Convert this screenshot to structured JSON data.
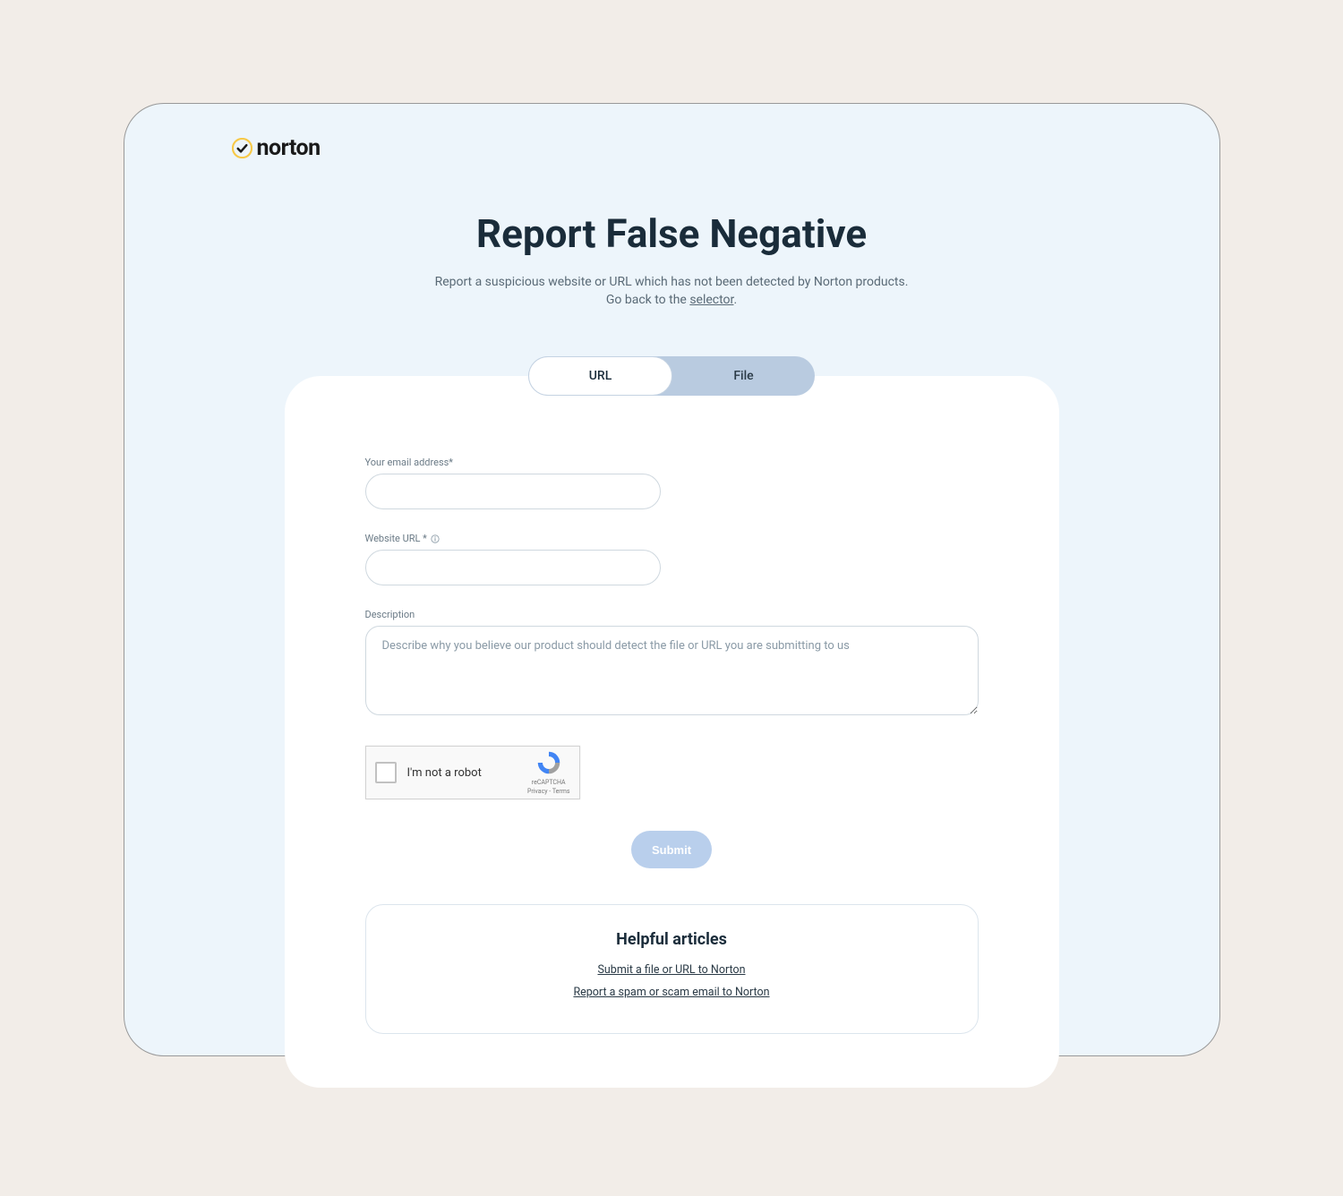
{
  "logo": {
    "text": "norton"
  },
  "header": {
    "title": "Report False Negative",
    "subtitle_line1": "Report a suspicious website or URL which has not been detected by Norton products.",
    "subtitle_line2_prefix": "Go back to the ",
    "subtitle_line2_link": "selector",
    "subtitle_line2_suffix": "."
  },
  "tabs": {
    "url": "URL",
    "file": "File"
  },
  "form": {
    "email_label": "Your email address*",
    "url_label": "Website URL *",
    "description_label": "Description",
    "description_placeholder": "Describe why you believe our product should detect the file or URL you are submitting to us",
    "submit_label": "Submit"
  },
  "recaptcha": {
    "label": "I'm not a robot",
    "brand": "reCAPTCHA",
    "terms": "Privacy - Terms"
  },
  "helpful": {
    "title": "Helpful articles",
    "link1": "Submit a file or URL to Norton",
    "link2": "Report a spam or scam email to Norton"
  }
}
